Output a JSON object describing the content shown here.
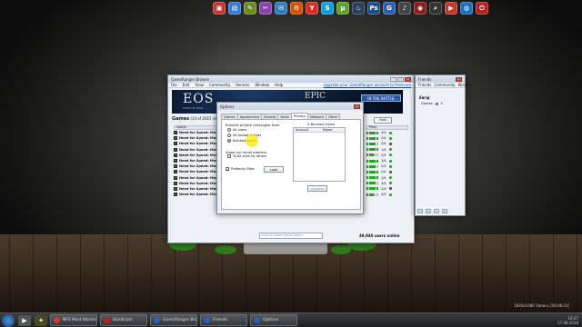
{
  "dock": {
    "icons": [
      {
        "name": "media-icon",
        "glyph": "▣",
        "color": "#c0392b"
      },
      {
        "name": "folder-icon",
        "glyph": "▤",
        "color": "#3a7bd5"
      },
      {
        "name": "settings-icon",
        "glyph": "✎",
        "color": "#6b8e23"
      },
      {
        "name": "tools-icon",
        "glyph": "✂",
        "color": "#8e44ad"
      },
      {
        "name": "mail-icon",
        "glyph": "✉",
        "color": "#2c7fb8"
      },
      {
        "name": "network-icon",
        "glyph": "⚙",
        "color": "#d35400"
      },
      {
        "name": "yandex-icon",
        "glyph": "Y",
        "color": "#d62d20"
      },
      {
        "name": "skype-icon",
        "glyph": "S",
        "color": "#0fa0e0"
      },
      {
        "name": "torrent-icon",
        "glyph": "µ",
        "color": "#5da130"
      },
      {
        "name": "steam-icon",
        "glyph": "♨",
        "color": "#2a3d5a"
      },
      {
        "name": "photoshop-icon",
        "glyph": "Ps",
        "color": "#1b4d8f"
      },
      {
        "name": "gameranger-icon",
        "glyph": "G",
        "color": "#2b5fb8"
      },
      {
        "name": "audio-icon",
        "glyph": "♪",
        "color": "#444"
      },
      {
        "name": "camera-icon",
        "glyph": "◉",
        "color": "#8a1d1d"
      },
      {
        "name": "search-icon",
        "glyph": "⌕",
        "color": "#333"
      },
      {
        "name": "player-icon",
        "glyph": "▶",
        "color": "#c0392b"
      },
      {
        "name": "globe-icon",
        "glyph": "◍",
        "color": "#1c6fb8"
      },
      {
        "name": "power-icon",
        "glyph": "⏻",
        "color": "#b22222"
      }
    ]
  },
  "gameranger": {
    "title": "GameRanger Browse",
    "menu": [
      "File",
      "Edit",
      "View",
      "Community",
      "Servers",
      "Window",
      "Help"
    ],
    "upgrade_link": "Upgrade your GameRanger account to Premium",
    "banner": {
      "title": "EOS",
      "subtitle": "ECHO OF SOUL",
      "tagline": "EPIC",
      "button": "IN THE BATTLE"
    },
    "games_label": "Games",
    "games_count": "(14 of 2015 rooms)",
    "list_header": "Game",
    "host_button": "Host",
    "ping_header": "Ping",
    "rows": [
      {
        "game": "Need for Speed: Most W",
        "players": "3/4",
        "ping": 5,
        "dot": true
      },
      {
        "game": "Need for Speed: Most W",
        "players": "2/4",
        "ping": 5,
        "dot": true
      },
      {
        "game": "Need for Speed: Most W",
        "players": "2/4",
        "ping": 4,
        "lock": true
      },
      {
        "game": "Need for Speed: Most W",
        "players": "1/4",
        "ping": 5,
        "dot": true
      },
      {
        "game": "Need for Speed: Most W",
        "players": "2/4",
        "ping": 3,
        "dot": true
      },
      {
        "game": "Need for Speed: Most W",
        "players": "3/4",
        "ping": 5,
        "dot": true
      },
      {
        "game": "Need for Speed: Most W",
        "players": "2/2",
        "ping": 4,
        "dot": true
      },
      {
        "game": "Need for Speed: Most W",
        "players": "2/4",
        "ping": 5,
        "lock": true
      },
      {
        "game": "Need for Speed: Most W",
        "players": "1/4",
        "ping": 5,
        "dot": true
      },
      {
        "game": "Need for Speed: Most W",
        "players": "3/4",
        "ping": 4,
        "dot": true
      },
      {
        "game": "Need for Speed: Most W",
        "players": "2/4",
        "ping": 5,
        "lock": true
      },
      {
        "game": "Need for Speed: Most W",
        "players": "4/4",
        "ping": 3,
        "dot": true
      }
    ],
    "search_placeholder": "Search Game Description",
    "status": "49,940 users online"
  },
  "options": {
    "title": "Options",
    "tabs": [
      "Games",
      "Appearance",
      "Sounds",
      "Voice",
      "Privacy",
      "Network",
      "Other"
    ],
    "active_tab": 4,
    "prevent_label": "Prevent private messages from",
    "radios": [
      "All users",
      "All except friends",
      "Blocked users"
    ],
    "selected_radio": 2,
    "email_label": "Allow my email address",
    "email_check": "To be seen by others",
    "profanity_check": "Profanity Filter",
    "profanity_checked": true,
    "look_button": "Look",
    "blocked_title": "0 Blocked Users",
    "blocked_cols": [
      "Account",
      "Name"
    ],
    "unblock_button": "Unblock"
  },
  "friends": {
    "title": "Friends",
    "menu": [
      "Friends",
      "Community",
      "Window"
    ],
    "user": "Евгаj",
    "group": "Games",
    "group_count": "0"
  },
  "taskbar": {
    "tasks": [
      {
        "label": "NFS Most Wanted",
        "color": "#d63c2a"
      },
      {
        "label": "Bandicam",
        "color": "#c21f1f"
      },
      {
        "label": "GameRanger Bro...",
        "color": "#2b5fb8"
      },
      {
        "label": "Friends",
        "color": "#2b5fb8"
      },
      {
        "label": "Options",
        "color": "#2b5fb8"
      }
    ],
    "tray_time": "19:27",
    "tray_date": "17.08.2016",
    "tray_info": "1920x1080",
    "tray_rec": "Запись [00:06:21]"
  }
}
